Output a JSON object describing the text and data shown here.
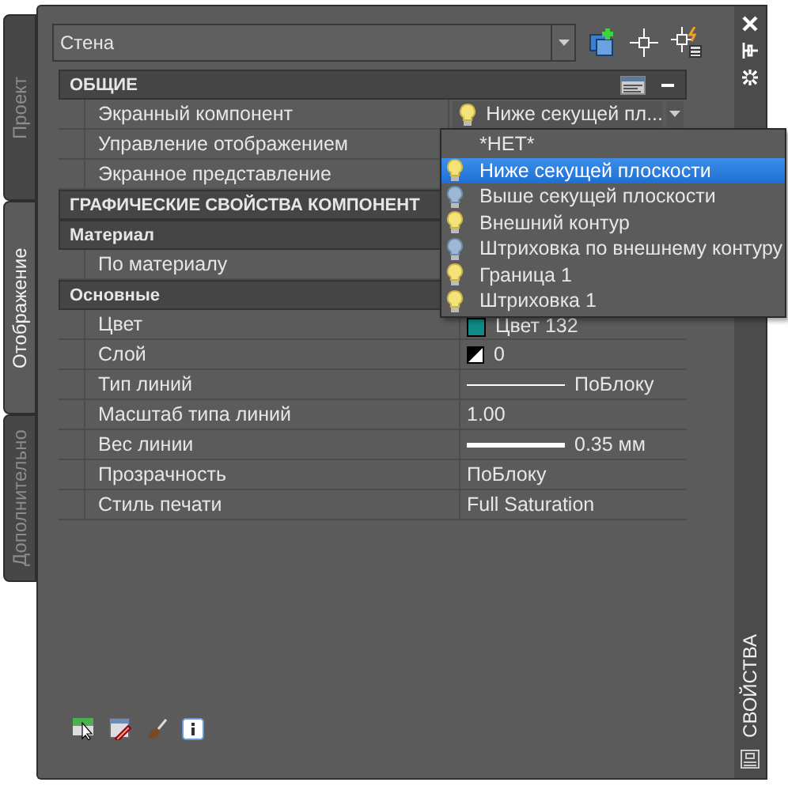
{
  "side_tabs": [
    {
      "label": "Проект",
      "selected": false
    },
    {
      "label": "Отображение",
      "selected": true
    },
    {
      "label": "Дополнительно",
      "selected": false
    }
  ],
  "object_select": {
    "value": "Стена"
  },
  "categories": [
    {
      "title": "ОБЩИЕ",
      "rows": [
        {
          "label": "Экранный компонент",
          "kind": "combo",
          "value": "Ниже секущей пл...",
          "lit": true
        },
        {
          "label": "Управление отображением",
          "kind": "empty"
        },
        {
          "label": "Экранное представление",
          "kind": "empty"
        }
      ]
    },
    {
      "title": "ГРАФИЧЕСКИЕ СВОЙСТВА КОМПОНЕНТ",
      "groups": [
        {
          "title": "Материал",
          "rows": [
            {
              "label": "По материалу",
              "kind": "empty"
            }
          ]
        },
        {
          "title": "Основные",
          "rows": [
            {
              "label": "Цвет",
              "kind": "color",
              "value": "Цвет 132",
              "color": "#0f8a86"
            },
            {
              "label": "Слой",
              "kind": "layer",
              "value": "0"
            },
            {
              "label": "Тип линий",
              "kind": "linetype",
              "value": "ПоБлоку"
            },
            {
              "label": "Масштаб типа линий",
              "kind": "text",
              "value": "1.00"
            },
            {
              "label": "Вес линии",
              "kind": "lineweight",
              "value": "0.35 мм"
            },
            {
              "label": "Прозрачность",
              "kind": "text",
              "value": "ПоБлоку"
            },
            {
              "label": "Стиль печати",
              "kind": "text",
              "value": "Full Saturation"
            }
          ]
        }
      ]
    }
  ],
  "component_list": [
    {
      "label": "*НЕТ*",
      "kind": "plain",
      "selected": false
    },
    {
      "label": "Ниже секущей плоскости",
      "kind": "bulb",
      "lit": true,
      "selected": true
    },
    {
      "label": "Выше секущей плоскости",
      "kind": "bulb",
      "lit": false,
      "selected": false
    },
    {
      "label": "Внешний контур",
      "kind": "bulb",
      "lit": true,
      "selected": false
    },
    {
      "label": "Штриховка по внешнему контуру",
      "kind": "bulb",
      "lit": false,
      "selected": false
    },
    {
      "label": "Граница 1",
      "kind": "bulb",
      "lit": true,
      "selected": false
    },
    {
      "label": "Штриховка 1",
      "kind": "bulb",
      "lit": true,
      "selected": false
    }
  ],
  "palette_title": "СВОЙСТВА"
}
